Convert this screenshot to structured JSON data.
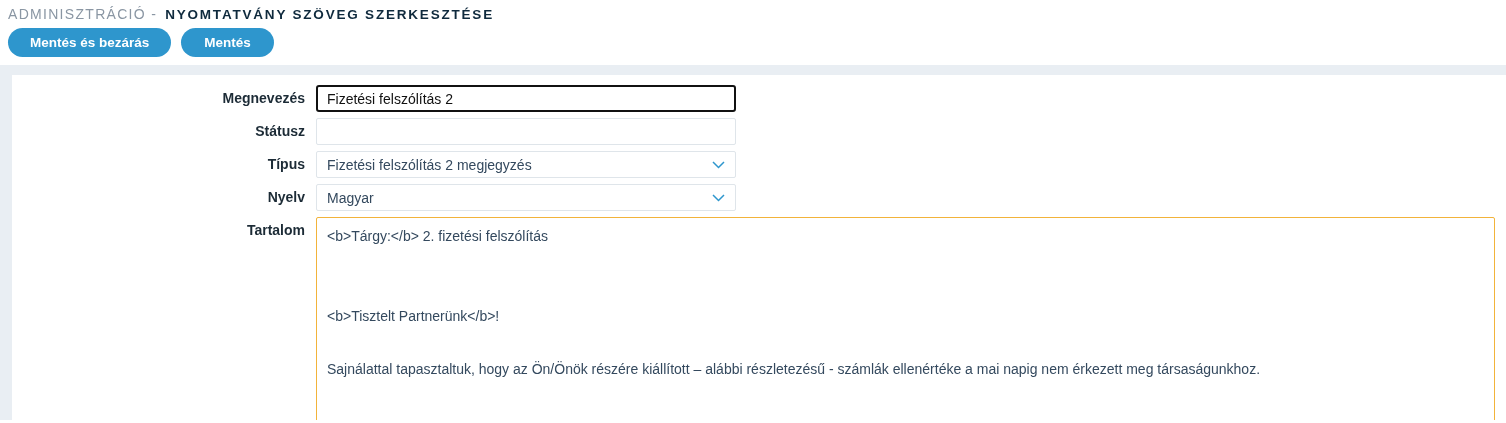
{
  "header": {
    "section": "ADMINISZTRÁCIÓ -",
    "title": "NYOMTATVÁNY SZÖVEG SZERKESZTÉSE"
  },
  "buttons": [
    "Mentés és bezárás",
    "Mentés"
  ],
  "form": {
    "fields": [
      {
        "label": "Megnevezés",
        "kind": "text",
        "value": "Fizetési felszólítás 2",
        "focused": true
      },
      {
        "label": "Státusz",
        "kind": "text",
        "focused": false
      },
      {
        "label": "Típus",
        "kind": "select",
        "value": "Fizetési felszólítás 2 megjegyzés",
        "focused": false
      },
      {
        "label": "Nyelv",
        "kind": "select",
        "value": "Magyar",
        "focused": false
      },
      {
        "label": "Tartalom",
        "kind": "textarea",
        "value": "<b>Tárgy:</b> 2. fizetési felszólítás\n\n\n<b>Tisztelt Partnerünk</b>!\n\nSajnálattal tapasztaltuk, hogy az Ön/Önök részére kiállított – alábbi részletezésű - számlák ellenértéke a mai napig nem érkezett meg társaságunkhoz.",
        "focused": false
      }
    ]
  }
}
